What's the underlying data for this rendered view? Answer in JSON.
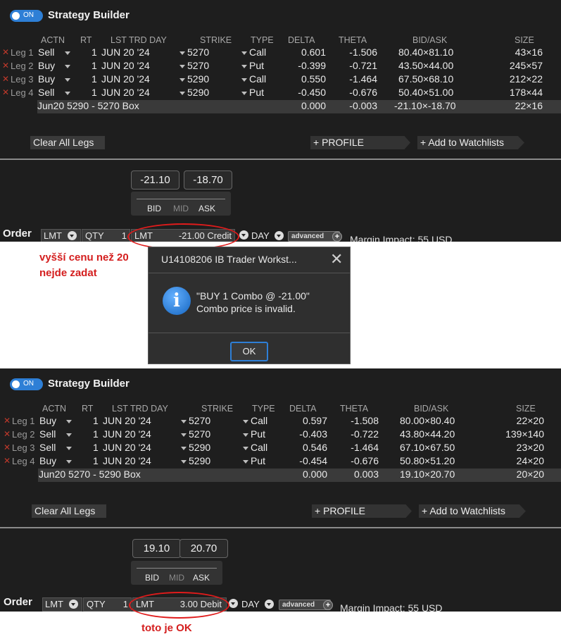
{
  "panel1": {
    "toggle_label": "ON",
    "title": "Strategy Builder",
    "headers": {
      "actn": "ACTN",
      "rt": "RT",
      "lst": "LST TRD DAY",
      "strike": "STRIKE",
      "type": "TYPE",
      "delta": "DELTA",
      "theta": "THETA",
      "bidask": "BID/ASK",
      "size": "SIZE"
    },
    "legs": [
      {
        "label": "Leg 1",
        "actn": "Sell",
        "rt": "1",
        "day": "JUN 20 '24",
        "strike": "5270",
        "type": "Call",
        "delta": "0.601",
        "theta": "-1.506",
        "bidask": "80.40×81.10",
        "size": "43×16"
      },
      {
        "label": "Leg 2",
        "actn": "Buy",
        "rt": "1",
        "day": "JUN 20 '24",
        "strike": "5270",
        "type": "Put",
        "delta": "-0.399",
        "theta": "-0.721",
        "bidask": "43.50×44.00",
        "size": "245×57"
      },
      {
        "label": "Leg 3",
        "actn": "Buy",
        "rt": "1",
        "day": "JUN 20 '24",
        "strike": "5290",
        "type": "Call",
        "delta": "0.550",
        "theta": "-1.464",
        "bidask": "67.50×68.10",
        "size": "212×22"
      },
      {
        "label": "Leg 4",
        "actn": "Sell",
        "rt": "1",
        "day": "JUN 20 '24",
        "strike": "5290",
        "type": "Put",
        "delta": "-0.450",
        "theta": "-0.676",
        "bidask": "50.40×51.00",
        "size": "178×44"
      }
    ],
    "box": {
      "name": "Jun20 5290 - 5270 Box",
      "delta": "0.000",
      "theta": "-0.003",
      "bidask": "-21.10×-18.70",
      "size": "22×16"
    },
    "clear_label": "Clear All Legs",
    "profile_label": "PROFILE",
    "watch_label": "Add to Watchlists",
    "bid_price": "-21.10",
    "ask_price": "-18.70",
    "scale": {
      "bid": "BID",
      "mid": "MID",
      "ask": "ASK"
    },
    "order_label": "Order",
    "ordtype": "LMT",
    "qty_label": "QTY",
    "qty": "1",
    "lmt_label": "LMT",
    "lmt_value": "-21.00 Credit",
    "tif": "DAY",
    "advanced": "advanced",
    "margin": "Margin Impact: 55 USD"
  },
  "annotation1": {
    "line1": "vyšší cenu než 20",
    "line2": "nejde zadat"
  },
  "dialog": {
    "title": "U14108206 IB Trader Workst...",
    "msg1": "\"BUY 1 Combo @ -21.00\"",
    "msg2": "Combo price is invalid.",
    "ok": "OK"
  },
  "panel2": {
    "toggle_label": "ON",
    "title": "Strategy Builder",
    "headers": {
      "actn": "ACTN",
      "rt": "RT",
      "lst": "LST TRD DAY",
      "strike": "STRIKE",
      "type": "TYPE",
      "delta": "DELTA",
      "theta": "THETA",
      "bidask": "BID/ASK",
      "size": "SIZE"
    },
    "legs": [
      {
        "label": "Leg 1",
        "actn": "Buy",
        "rt": "1",
        "day": "JUN 20 '24",
        "strike": "5270",
        "type": "Call",
        "delta": "0.597",
        "theta": "-1.508",
        "bidask": "80.00×80.40",
        "size": "22×20"
      },
      {
        "label": "Leg 2",
        "actn": "Sell",
        "rt": "1",
        "day": "JUN 20 '24",
        "strike": "5270",
        "type": "Put",
        "delta": "-0.403",
        "theta": "-0.722",
        "bidask": "43.80×44.20",
        "size": "139×140"
      },
      {
        "label": "Leg 3",
        "actn": "Sell",
        "rt": "1",
        "day": "JUN 20 '24",
        "strike": "5290",
        "type": "Call",
        "delta": "0.546",
        "theta": "-1.464",
        "bidask": "67.10×67.50",
        "size": "23×20"
      },
      {
        "label": "Leg 4",
        "actn": "Buy",
        "rt": "1",
        "day": "JUN 20 '24",
        "strike": "5290",
        "type": "Put",
        "delta": "-0.454",
        "theta": "-0.676",
        "bidask": "50.80×51.20",
        "size": "24×20"
      }
    ],
    "box": {
      "name": "Jun20 5270 - 5290 Box",
      "delta": "0.000",
      "theta": "0.003",
      "bidask": "19.10×20.70",
      "size": "20×20"
    },
    "clear_label": "Clear All Legs",
    "profile_label": "PROFILE",
    "watch_label": "Add to Watchlists",
    "bid_price": "19.10",
    "ask_price": "20.70",
    "scale": {
      "bid": "BID",
      "mid": "MID",
      "ask": "ASK"
    },
    "order_label": "Order",
    "ordtype": "LMT",
    "qty_label": "QTY",
    "qty": "1",
    "lmt_label": "LMT",
    "lmt_value": "3.00 Debit",
    "tif": "DAY",
    "advanced": "advanced",
    "margin": "Margin Impact: 55 USD"
  },
  "annotation2": {
    "line1": "toto je OK"
  }
}
